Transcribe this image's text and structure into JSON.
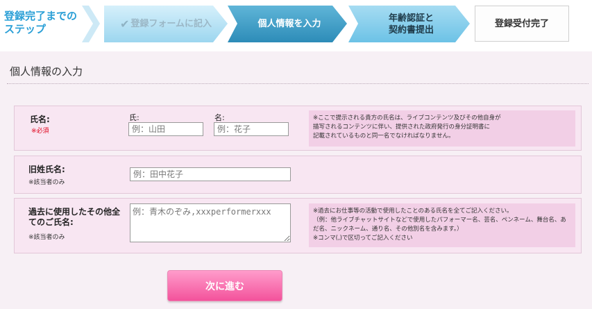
{
  "steps": {
    "lead": "登録完了までの\nステップ",
    "step1": "登録フォームに記入",
    "step2": "個人情報を入力",
    "step3": "年齢認証と\n契約書提出",
    "step4": "登録受付完了"
  },
  "section": {
    "title": "個人情報の入力"
  },
  "form": {
    "name": {
      "label": "氏名:",
      "required": "※必須",
      "last_label": "氏:",
      "last_placeholder": "例：山田",
      "first_label": "名:",
      "first_placeholder": "例：花子",
      "note": "※ここで提示される貴方の氏名は、ライブコンテンツ及びその他自身が\n描写されるコンテンツに伴い、提供された政府発行の身分証明書に\n記載されているものと同一名でなければなりません。"
    },
    "maiden": {
      "label": "旧姓氏名:",
      "sub": "※該当者のみ",
      "placeholder": "例：田中花子"
    },
    "aliases": {
      "label": "過去に使用したその他全\nてのご氏名:",
      "sub": "※該当者のみ",
      "placeholder": "例：青木のぞみ,xxxperformerxxx",
      "note": "※過去にお仕事等の活動で使用したことのある氏名を全てご記入ください。\n（例：他ライブチャットサイトなどで使用したパフォーマー名、芸名、ペンネーム、舞台名、あだ名、ニックネーム、通り名、その他別名を含みます。）\n※コンマ(,)で区切ってご記入ください"
    }
  },
  "next_button": "次に進む",
  "colors": {
    "accent_blue": "#2a9fd6",
    "active_step": "#2d8cb8",
    "button_pink": "#f3529b",
    "required_red": "#e0001a"
  }
}
